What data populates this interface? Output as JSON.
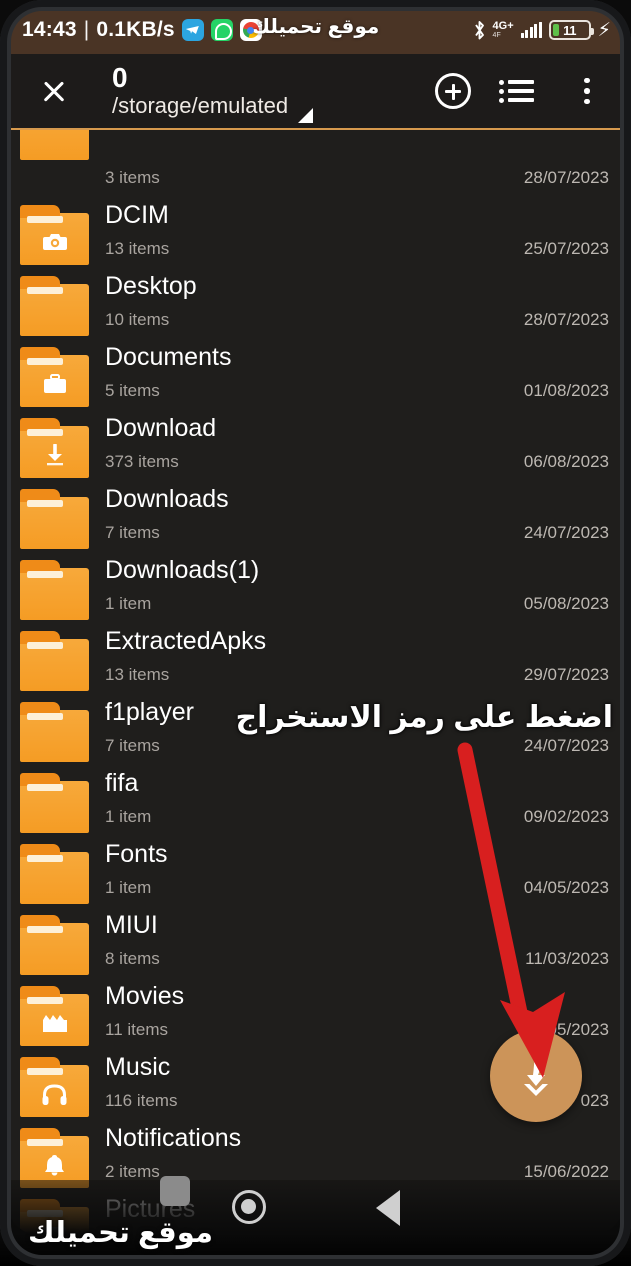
{
  "status_bar": {
    "time": "14:43",
    "separator": "|",
    "network_speed": "0.1KB/s",
    "app_icons": [
      "telegram-icon",
      "whatsapp-icon",
      "chrome-icon"
    ],
    "watermark": "موقع تحميلك",
    "bluetooth_icon": "bluetooth-icon",
    "network_type": "4G+",
    "network_band": "4F",
    "signal_icon": "signal-bars-icon",
    "battery_percent": "11",
    "charging_icon": "⚡"
  },
  "toolbar": {
    "close_icon": "close-icon",
    "title": "0",
    "subtitle": "/storage/emulated",
    "dropdown_icon": "caret-icon",
    "add_label": "plus-circle-icon",
    "view_label": "list-view-icon",
    "menu_label": "overflow-menu-icon",
    "accent_color": "#d79a4e"
  },
  "list": {
    "rows": [
      {
        "name": "",
        "items": "3 items",
        "date": "28/07/2023",
        "glyph": "",
        "partial": true
      },
      {
        "name": "DCIM",
        "items": "13 items",
        "date": "25/07/2023",
        "glyph": "camera"
      },
      {
        "name": "Desktop",
        "items": "10 items",
        "date": "28/07/2023",
        "glyph": ""
      },
      {
        "name": "Documents",
        "items": "5 items",
        "date": "01/08/2023",
        "glyph": "briefcase"
      },
      {
        "name": "Download",
        "items": "373 items",
        "date": "06/08/2023",
        "glyph": "download"
      },
      {
        "name": "Downloads",
        "items": "7 items",
        "date": "24/07/2023",
        "glyph": ""
      },
      {
        "name": "Downloads(1)",
        "items": "1 item",
        "date": "05/08/2023",
        "glyph": ""
      },
      {
        "name": "ExtractedApks",
        "items": "13 items",
        "date": "29/07/2023",
        "glyph": ""
      },
      {
        "name": "f1player",
        "items": "7 items",
        "date": "24/07/2023",
        "glyph": ""
      },
      {
        "name": "fifa",
        "items": "1 item",
        "date": "09/02/2023",
        "glyph": ""
      },
      {
        "name": "Fonts",
        "items": "1 item",
        "date": "04/05/2023",
        "glyph": ""
      },
      {
        "name": "MIUI",
        "items": "8 items",
        "date": "11/03/2023",
        "glyph": ""
      },
      {
        "name": "Movies",
        "items": "11 items",
        "date": "05/2023",
        "glyph": "movie"
      },
      {
        "name": "Music",
        "items": "116 items",
        "date": "023",
        "glyph": "headphones"
      },
      {
        "name": "Notifications",
        "items": "2 items",
        "date": "15/06/2022",
        "glyph": "bell"
      },
      {
        "name": "Pictures",
        "items": "",
        "date": "",
        "glyph": "image"
      }
    ]
  },
  "fab": {
    "name": "extract-button",
    "icon": "extract-download-icon",
    "color": "#cc9459"
  },
  "annotation": {
    "text": "اضغط على رمز الاستخراج",
    "arrow_color": "#d81f1f"
  },
  "nav_bar": {
    "home": "home-button",
    "back": "back-button",
    "recent": "recent-apps-button"
  },
  "bottom_watermark": "موقع تحميلك"
}
